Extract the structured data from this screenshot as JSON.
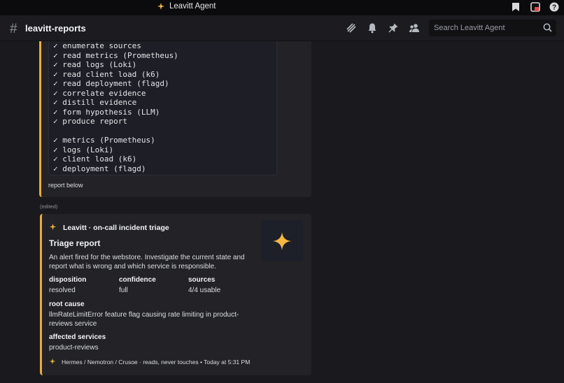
{
  "titlebar": {
    "app_name": "Leavitt Agent"
  },
  "header": {
    "channel_prefix": "#",
    "channel_name": "leavitt-reports",
    "search_placeholder": "Search Leavitt Agent"
  },
  "colors": {
    "accent": "#f0a93b",
    "star": "#f5b742",
    "embed_bg": "#232327"
  },
  "first_embed": {
    "code_lines": [
      "✓ enumerate sources",
      "✓ read metrics (Prometheus)",
      "✓ read logs (Loki)",
      "✓ read client load (k6)",
      "✓ read deployment (flagd)",
      "✓ correlate evidence",
      "✓ distill evidence",
      "✓ form hypothesis (LLM)",
      "✓ produce report",
      "",
      "✓ metrics (Prometheus)",
      "✓ logs (Loki)",
      "✓ client load (k6)",
      "✓ deployment (flagd)"
    ],
    "message": "report below",
    "edited": "(edited)"
  },
  "embed": {
    "author": "Leavitt · on-call incident triage",
    "title": "Triage report",
    "description": "An alert fired for the webstore. Investigate the current state and report what is wrong and which service is responsible.",
    "fields": {
      "disposition": {
        "name": "disposition",
        "value": "resolved"
      },
      "confidence": {
        "name": "confidence",
        "value": "full"
      },
      "sources": {
        "name": "sources",
        "value": "4/4 usable"
      },
      "root_cause": {
        "name": "root cause",
        "value": "llmRateLimitError feature flag causing rate limiting in product-reviews service"
      },
      "affected": {
        "name": "affected services",
        "value": "product-reviews"
      }
    },
    "footer": "Hermes / Nemotron / Crusoe · reads, never touches • Today at 5:31 PM"
  }
}
